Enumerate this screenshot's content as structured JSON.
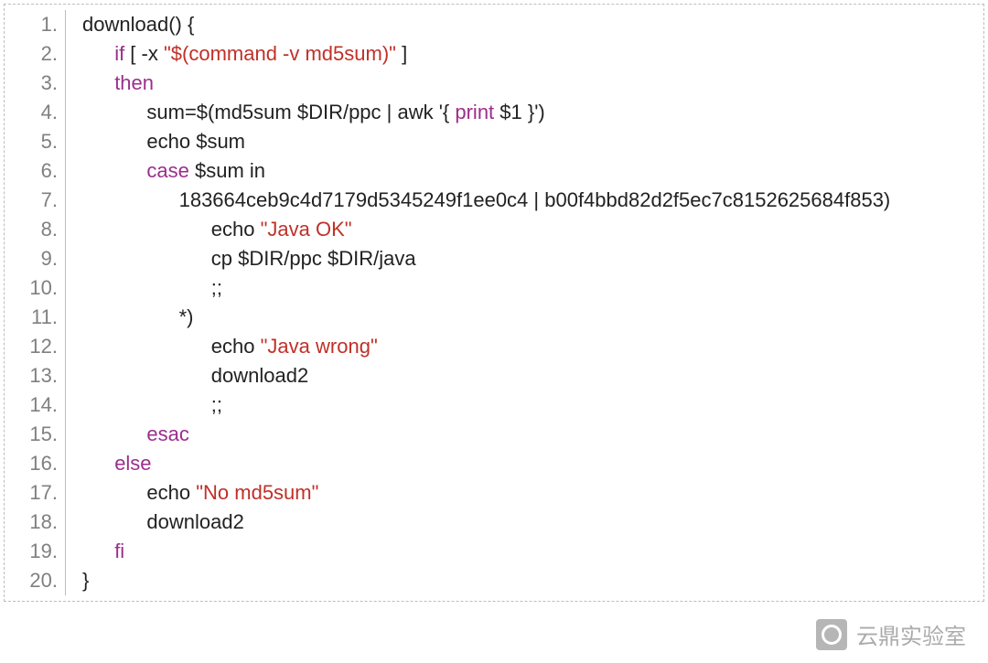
{
  "watermark": {
    "label": "云鼎实验室"
  },
  "lines": [
    {
      "n": "1.",
      "indent": 0,
      "tokens": [
        {
          "t": "download() {"
        }
      ]
    },
    {
      "n": "2.",
      "indent": 1,
      "tokens": [
        {
          "t": "if",
          "cls": "kw"
        },
        {
          "t": " [ -x "
        },
        {
          "t": "\"$(command -v md5sum)\"",
          "cls": "str"
        },
        {
          "t": " ]"
        }
      ]
    },
    {
      "n": "3.",
      "indent": 1,
      "tokens": [
        {
          "t": "then",
          "cls": "kw"
        }
      ]
    },
    {
      "n": "4.",
      "indent": 2,
      "tokens": [
        {
          "t": "sum=$(md5sum $DIR/ppc | awk '{ "
        },
        {
          "t": "print",
          "cls": "kw"
        },
        {
          "t": " $1 }')"
        }
      ]
    },
    {
      "n": "5.",
      "indent": 2,
      "tokens": [
        {
          "t": "echo $sum"
        }
      ]
    },
    {
      "n": "6.",
      "indent": 2,
      "tokens": [
        {
          "t": "case",
          "cls": "kw"
        },
        {
          "t": " $sum in"
        }
      ]
    },
    {
      "n": "7.",
      "indent": 3,
      "tokens": [
        {
          "t": "183664ceb9c4d7179d5345249f1ee0c4 | b00f4bbd82d2f5ec7c8152625684f853)"
        }
      ]
    },
    {
      "n": "8.",
      "indent": 4,
      "tokens": [
        {
          "t": "echo "
        },
        {
          "t": "\"Java OK\"",
          "cls": "str"
        }
      ]
    },
    {
      "n": "9.",
      "indent": 4,
      "tokens": [
        {
          "t": "cp $DIR/ppc $DIR/java"
        }
      ]
    },
    {
      "n": "10.",
      "indent": 4,
      "tokens": [
        {
          "t": ";;"
        }
      ]
    },
    {
      "n": "11.",
      "indent": 3,
      "tokens": [
        {
          "t": "*)"
        }
      ]
    },
    {
      "n": "12.",
      "indent": 4,
      "tokens": [
        {
          "t": "echo "
        },
        {
          "t": "\"Java wrong\"",
          "cls": "str"
        }
      ]
    },
    {
      "n": "13.",
      "indent": 4,
      "tokens": [
        {
          "t": "download2"
        }
      ]
    },
    {
      "n": "14.",
      "indent": 4,
      "tokens": [
        {
          "t": ";;"
        }
      ]
    },
    {
      "n": "15.",
      "indent": 2,
      "tokens": [
        {
          "t": "esac",
          "cls": "kw"
        }
      ]
    },
    {
      "n": "16.",
      "indent": 1,
      "tokens": [
        {
          "t": "else",
          "cls": "kw"
        }
      ]
    },
    {
      "n": "17.",
      "indent": 2,
      "tokens": [
        {
          "t": "echo "
        },
        {
          "t": "\"No md5sum\"",
          "cls": "str"
        }
      ]
    },
    {
      "n": "18.",
      "indent": 2,
      "tokens": [
        {
          "t": "download2"
        }
      ]
    },
    {
      "n": "19.",
      "indent": 1,
      "tokens": [
        {
          "t": "fi",
          "cls": "kw"
        }
      ]
    },
    {
      "n": "20.",
      "indent": 0,
      "tokens": [
        {
          "t": "}"
        }
      ]
    }
  ]
}
